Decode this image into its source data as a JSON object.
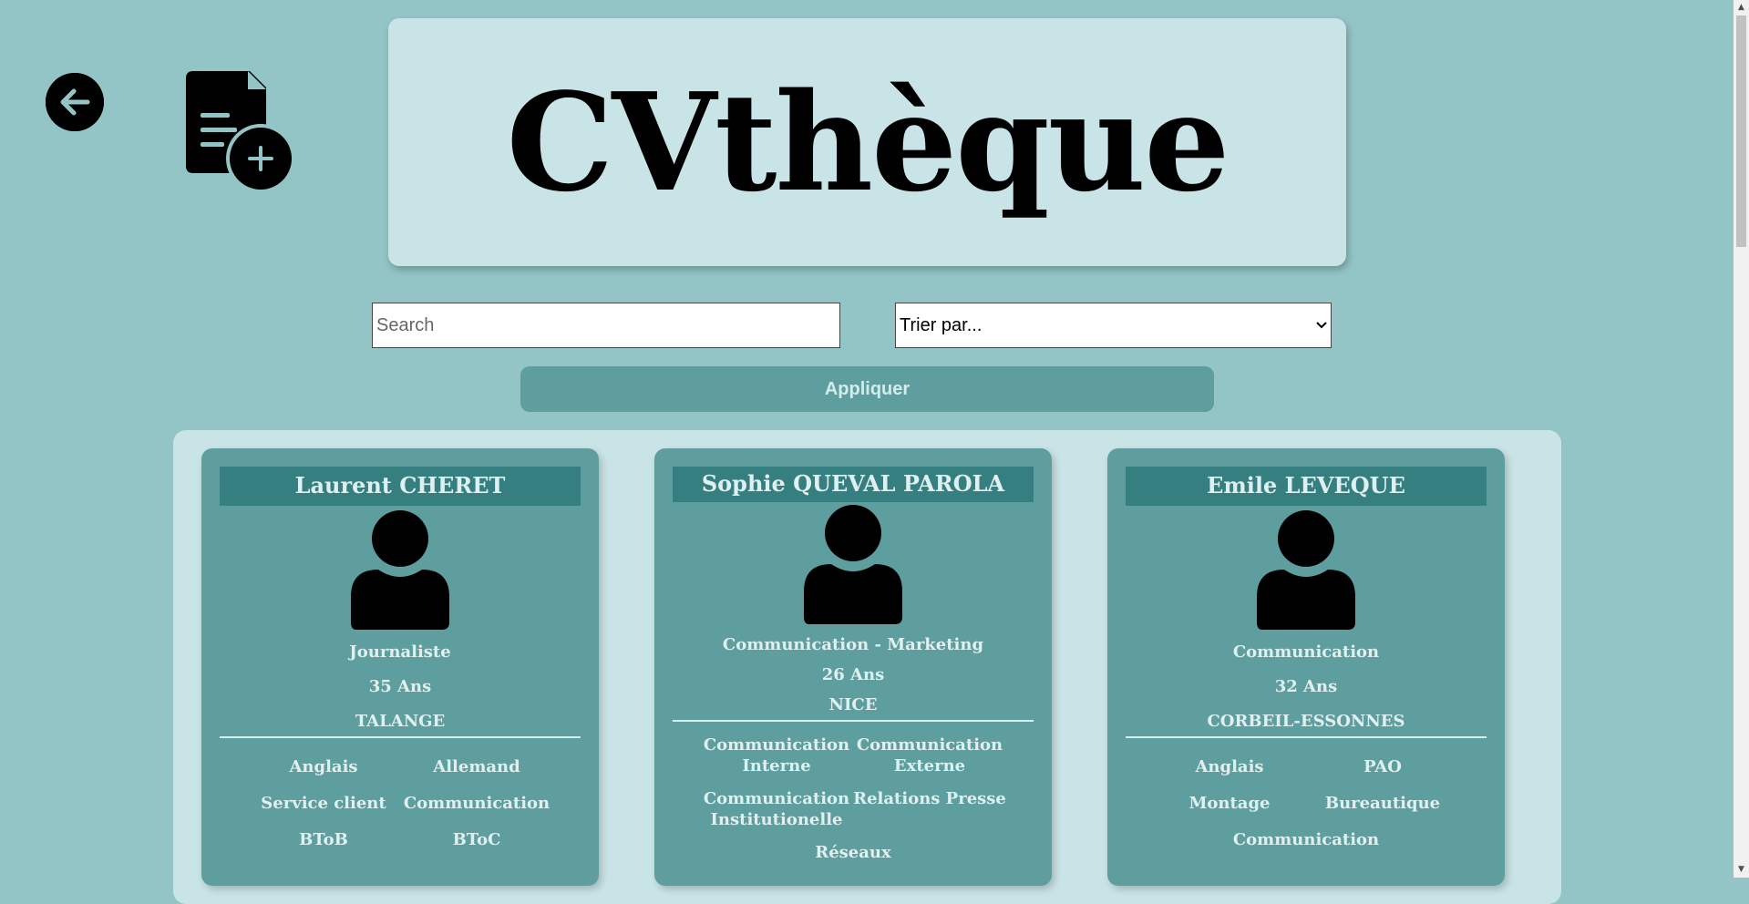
{
  "header": {
    "title": "CVthèque"
  },
  "icons": {
    "back": "arrow-left-circle-icon",
    "add_cv": "file-add-icon",
    "avatar": "user-silhouette-icon",
    "dropdown": "chevron-down-icon"
  },
  "search": {
    "placeholder": "Search",
    "value": ""
  },
  "sort": {
    "selected": "Trier par..."
  },
  "apply_label": "Appliquer",
  "colors": {
    "page_background": "#93c5c6",
    "panel_background": "#c9e4e6",
    "card_background": "#5e9e9f",
    "card_name_background": "#357f80",
    "text_light": "#e0f0f0"
  },
  "cards": [
    {
      "name": "Laurent CHERET",
      "role": "Journaliste",
      "age": "35 Ans",
      "city": "TALANGE",
      "skills": [
        "Anglais",
        "Allemand",
        "Service client",
        "Communication",
        "BToB",
        "BToC"
      ]
    },
    {
      "name": "Sophie QUEVAL PAROLA",
      "role": "Communication - Marketing",
      "age": "26 Ans",
      "city": "NICE",
      "skills": [
        "Communication Interne",
        "Communication Externe",
        "Communication Institutionelle",
        "Relations Presse",
        "Réseaux"
      ]
    },
    {
      "name": "Emile LEVEQUE",
      "role": "Communication",
      "age": "32 Ans",
      "city": "CORBEIL-ESSONNES",
      "skills": [
        "Anglais",
        "PAO",
        "Montage",
        "Bureautique",
        "Communication"
      ]
    }
  ]
}
